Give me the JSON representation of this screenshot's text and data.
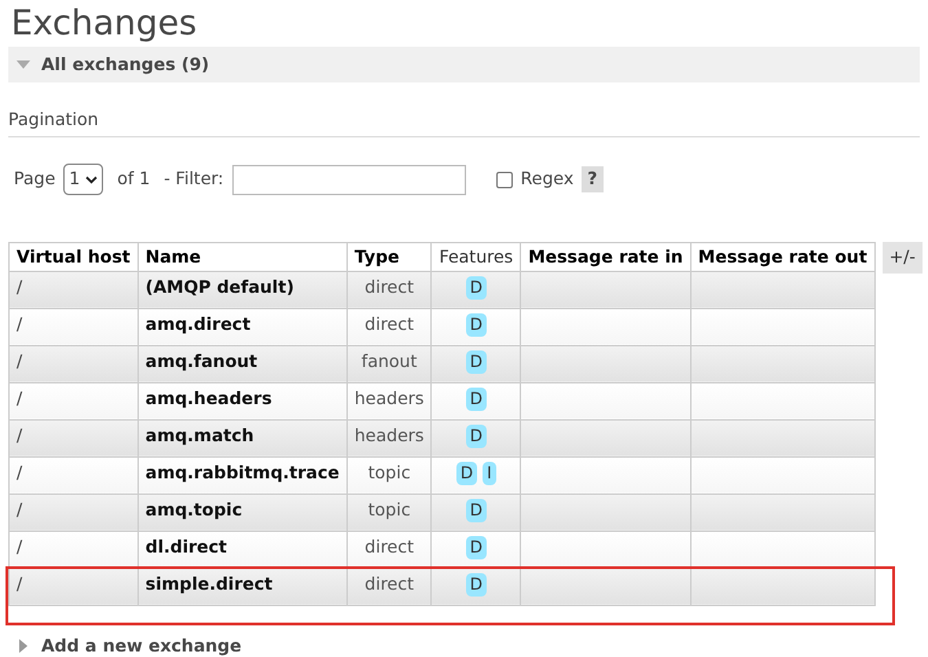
{
  "title": "Exchanges",
  "section": {
    "label": "All exchanges (9)",
    "expanded": true
  },
  "pagination": {
    "label": "Pagination",
    "page_label": "Page",
    "page": "1",
    "of": "of 1",
    "filter_label": "- Filter:",
    "regex_label": "Regex",
    "regex_checked": false,
    "help": "?"
  },
  "table": {
    "columns": [
      "Virtual host",
      "Name",
      "Type",
      "Features",
      "Message rate in",
      "Message rate out"
    ],
    "toggle": "+/-",
    "rows": [
      {
        "vhost": "/",
        "name": "(AMQP default)",
        "type": "direct",
        "features": [
          "D"
        ],
        "highlighted": false
      },
      {
        "vhost": "/",
        "name": "amq.direct",
        "type": "direct",
        "features": [
          "D"
        ],
        "highlighted": false
      },
      {
        "vhost": "/",
        "name": "amq.fanout",
        "type": "fanout",
        "features": [
          "D"
        ],
        "highlighted": false
      },
      {
        "vhost": "/",
        "name": "amq.headers",
        "type": "headers",
        "features": [
          "D"
        ],
        "highlighted": false
      },
      {
        "vhost": "/",
        "name": "amq.match",
        "type": "headers",
        "features": [
          "D"
        ],
        "highlighted": false
      },
      {
        "vhost": "/",
        "name": "amq.rabbitmq.trace",
        "type": "topic",
        "features": [
          "D",
          "I"
        ],
        "highlighted": false
      },
      {
        "vhost": "/",
        "name": "amq.topic",
        "type": "topic",
        "features": [
          "D"
        ],
        "highlighted": false
      },
      {
        "vhost": "/",
        "name": "dl.direct",
        "type": "direct",
        "features": [
          "D"
        ],
        "highlighted": false
      },
      {
        "vhost": "/",
        "name": "simple.direct",
        "type": "direct",
        "features": [
          "D"
        ],
        "highlighted": true
      }
    ]
  },
  "add_section": {
    "label": "Add a new exchange",
    "expanded": false
  }
}
